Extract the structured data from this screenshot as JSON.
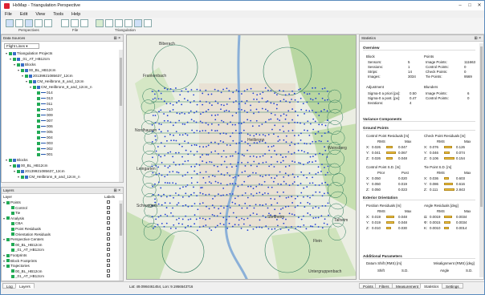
{
  "window": {
    "title": "HxMap - Triangulation Perspective"
  },
  "menu": [
    "File",
    "Edit",
    "View",
    "Tools",
    "Help"
  ],
  "ribbon": {
    "groups": [
      "Perspectives",
      "File",
      "Triangulation"
    ]
  },
  "project_panel": {
    "filter_value": "Flight Lines",
    "rows": [
      {
        "indent": 1,
        "text": "Triangulation Projects"
      },
      {
        "indent": 2,
        "text": "_01_AT_HB12cm"
      },
      {
        "indent": 3,
        "text": "Blocks"
      },
      {
        "indent": 4,
        "text": "00_BL_HB12cm"
      },
      {
        "indent": 5,
        "text": "20139921085637_12cm"
      },
      {
        "indent": 6,
        "text": "CM_Heilbronn_8_and_12cm"
      },
      {
        "indent": 7,
        "text": "CM_Heilbronn_8_and_12cm_n"
      },
      {
        "indent": 8,
        "text": "014"
      },
      {
        "indent": 8,
        "text": "013"
      },
      {
        "indent": 8,
        "text": "011"
      },
      {
        "indent": 8,
        "text": "010"
      },
      {
        "indent": 8,
        "text": "009"
      },
      {
        "indent": 8,
        "text": "007"
      },
      {
        "indent": 8,
        "text": "006"
      },
      {
        "indent": 8,
        "text": "005"
      },
      {
        "indent": 8,
        "text": "004"
      },
      {
        "indent": 8,
        "text": "003"
      },
      {
        "indent": 8,
        "text": "002"
      },
      {
        "indent": 8,
        "text": "001"
      },
      {
        "indent": 1,
        "text": "Blocks"
      },
      {
        "indent": 2,
        "text": "00_BL_HB12cm"
      },
      {
        "indent": 3,
        "text": "20139921085637_12cm"
      },
      {
        "indent": 4,
        "text": "CM_Heilbronn_8_and_12cm_n"
      }
    ]
  },
  "layers_panel": {
    "title": "Layers",
    "col_layer": "Layer",
    "col_labels": "Labels",
    "rows": [
      {
        "indent": 0,
        "text": "Points"
      },
      {
        "indent": 1,
        "text": "Control"
      },
      {
        "indent": 1,
        "text": "Tie"
      },
      {
        "indent": 0,
        "text": "Analysis"
      },
      {
        "indent": 1,
        "text": "CBA"
      },
      {
        "indent": 1,
        "text": "Point Residuals"
      },
      {
        "indent": 1,
        "text": "Orientation Residuals"
      },
      {
        "indent": 0,
        "text": "Perspective Centers"
      },
      {
        "indent": 1,
        "text": "00_BL_HB12cm"
      },
      {
        "indent": 1,
        "text": "_01_AT_HB12cm"
      },
      {
        "indent": 0,
        "text": "Footprints"
      },
      {
        "indent": 0,
        "text": "Block Footprints"
      },
      {
        "indent": 0,
        "text": "Trajectories"
      },
      {
        "indent": 1,
        "text": "00_BL_HB12cm"
      },
      {
        "indent": 1,
        "text": "_01_AT_HB12cm"
      }
    ]
  },
  "bottom_tabs_left": [
    "Log",
    "Layers"
  ],
  "status": {
    "coords": "Lat: 49.0984461454, Lon: 9.1956543716"
  },
  "stats": {
    "title": "Statistics",
    "overview": "Overview",
    "block_label": "Block",
    "points_label": "Points",
    "block": [
      {
        "k": "Sensors:",
        "v": "5"
      },
      {
        "k": "Sessions:",
        "v": "1"
      },
      {
        "k": "Strips:",
        "v": "14"
      },
      {
        "k": "Images:",
        "v": "3034"
      }
    ],
    "points": [
      {
        "k": "Image Points:",
        "v": "111663"
      },
      {
        "k": "Control Points:",
        "v": "0"
      },
      {
        "k": "Check Points:",
        "v": "0"
      },
      {
        "k": "Tie Points:",
        "v": "9569"
      }
    ],
    "adjustment_label": "Adjustment",
    "blunders_label": "Blunders",
    "adjustment": [
      {
        "k": "Sigma-0 a priori [px]:",
        "v": "0.50"
      },
      {
        "k": "Sigma-0 a post. [px]:",
        "v": "0.47"
      },
      {
        "k": "Iterations:",
        "v": "4"
      }
    ],
    "blunders": [
      {
        "k": "Image Points:",
        "v": "6"
      },
      {
        "k": "Control Points:",
        "v": "0"
      }
    ],
    "variance": "Variance Components",
    "ground_points": "Ground Points",
    "cp_residuals": "Control Point Residuals [m]",
    "ck_residuals": "Check Point Residuals [m]",
    "rms": "RMS",
    "max": "Max",
    "cp_rows": [
      {
        "axis": "X:",
        "rms": "0.026",
        "max": "0.047"
      },
      {
        "axis": "Y:",
        "rms": "0.041",
        "max": "0.067"
      },
      {
        "axis": "Z:",
        "rms": "0.026",
        "max": "0.048"
      }
    ],
    "ck_rows": [
      {
        "axis": "X:",
        "rms": "0.076",
        "max": "0.126"
      },
      {
        "axis": "Y:",
        "rms": "0.046",
        "max": "0.074"
      },
      {
        "axis": "Z:",
        "rms": "0.106",
        "max": "0.154"
      }
    ],
    "cp_sd": "Control Point S.D. [m]",
    "tp_sd": "Tie Point S.D. [m]",
    "prior": "Prior",
    "post": "Post",
    "cp_sd_rows": [
      {
        "axis": "X:",
        "prior": "0.050",
        "post": "0.020"
      },
      {
        "axis": "Y:",
        "prior": "0.050",
        "post": "0.019"
      },
      {
        "axis": "Z:",
        "prior": "0.050",
        "post": "0.023"
      }
    ],
    "tp_sd_rows": [
      {
        "axis": "X:",
        "rms": "0.036",
        "max": "0.603"
      },
      {
        "axis": "Y:",
        "rms": "0.086",
        "max": "0.616"
      },
      {
        "axis": "Z:",
        "rms": "0.111",
        "max": "2.843"
      }
    ],
    "exterior": "Exterior Orientation",
    "pos_residuals": "Position Residuals [m]",
    "ang_residuals": "Angle Residuals [deg]",
    "pos_rows": [
      {
        "axis": "X:",
        "rms": "0.019",
        "max": "0.048"
      },
      {
        "axis": "Y:",
        "rms": "0.019",
        "max": "0.048"
      },
      {
        "axis": "Z:",
        "rms": "0.010",
        "max": "0.030"
      }
    ],
    "ang_rows": [
      {
        "axis": "Ω:",
        "rms": "0.0019",
        "max": "0.0034"
      },
      {
        "axis": "Φ:",
        "rms": "0.0015",
        "max": "0.0034"
      },
      {
        "axis": "K:",
        "rms": "0.0010",
        "max": "0.0014"
      }
    ],
    "additional": "Additional Parameters",
    "datum_shift": "Datum Shift (RMS) [m]",
    "misalign": "Misalignment (RMS) [deg]",
    "shift": "Shift",
    "sd": "S.D.",
    "angle": "Angle",
    "tabs": [
      "Points",
      "Filters",
      "Measurement",
      "Statistics",
      "Settings"
    ]
  },
  "map": {
    "labels": [
      "Biberach",
      "Frankenbach",
      "Heilbronn",
      "Sontheim",
      "Flein",
      "Talheim",
      "Leingarten",
      "Schwaigern",
      "Weinsberg",
      "Untergruppenbach",
      "Nordhausen"
    ]
  }
}
